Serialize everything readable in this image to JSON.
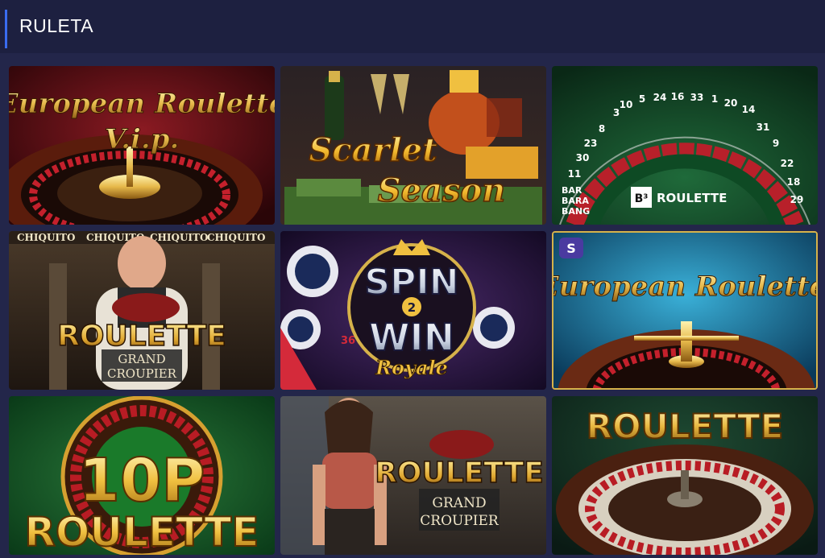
{
  "header": {
    "title": "RULETA"
  },
  "games": [
    {
      "line1": "European Roulette",
      "line2": "V.i.p."
    },
    {
      "line1": "Scarlet",
      "line2": "Season"
    },
    {
      "brand": [
        "BAR",
        "BARA",
        "BANG"
      ],
      "logo_mark": "B³",
      "label": "ROULETTE",
      "numbers": [
        "3",
        "10",
        "5",
        "24",
        "16",
        "33",
        "1",
        "20",
        "14",
        "31",
        "9",
        "22",
        "18",
        "29"
      ],
      "inner_numbers": [
        "8",
        "23",
        "30",
        "11"
      ]
    },
    {
      "banner": [
        "CHIQUITO",
        "CHIQUITO",
        "CHIQUITO",
        "CHIQUITO"
      ],
      "title": "ROULETTE",
      "subtitle1": "GRAND",
      "subtitle2": "CROUPIER"
    },
    {
      "line1": "SPIN",
      "badge": "2",
      "line2": "WIN",
      "line3": "Royale",
      "chip_number": "36"
    },
    {
      "logo": "S",
      "line1": "European Roulette"
    },
    {
      "line1": "10P",
      "line2": "ROULETTE"
    },
    {
      "title": "ROULETTE",
      "subtitle1": "GRAND",
      "subtitle2": "CROUPIER"
    },
    {
      "title": "ROULETTE"
    }
  ]
}
